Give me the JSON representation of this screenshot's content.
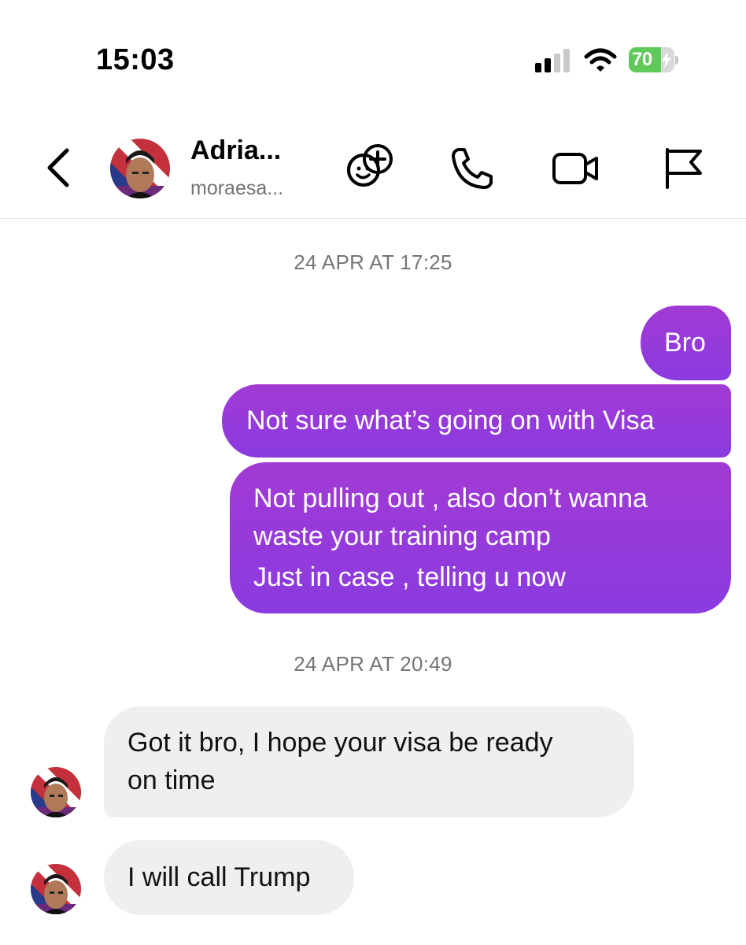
{
  "status_bar": {
    "time": "15:03",
    "battery_level": "70",
    "battery_charge_fraction": 0.7,
    "icons": [
      "signal-icon",
      "wifi-icon",
      "battery-charging-icon"
    ]
  },
  "header": {
    "name": "Adria...",
    "username": "moraesa...",
    "icons": [
      "back-chevron-icon",
      "avatar",
      "add-effects-icon",
      "phone-icon",
      "video-camera-icon",
      "flag-icon"
    ]
  },
  "conversation": {
    "timestamp_1": "24 APR AT 17:25",
    "timestamp_2": "24 APR AT 20:49",
    "sent_messages": [
      {
        "lines": [
          "Bro"
        ]
      },
      {
        "lines": [
          "Not sure what’s going on with Visa"
        ]
      },
      {
        "lines": [
          "Not pulling out , also don’t wanna",
          "waste your training camp",
          "Just in case , telling u now"
        ]
      }
    ],
    "received_messages": [
      {
        "lines": [
          "Got it bro, I hope your visa be ready",
          "on time"
        ]
      },
      {
        "lines": [
          "I will call Trump"
        ]
      }
    ]
  },
  "colors": {
    "sent_bubble_top": "#a23ad4",
    "sent_bubble_bottom": "#8a3be0",
    "received_bubble": "#efefef",
    "timestamp_text": "#757575",
    "battery_green": "#5fca5a"
  }
}
